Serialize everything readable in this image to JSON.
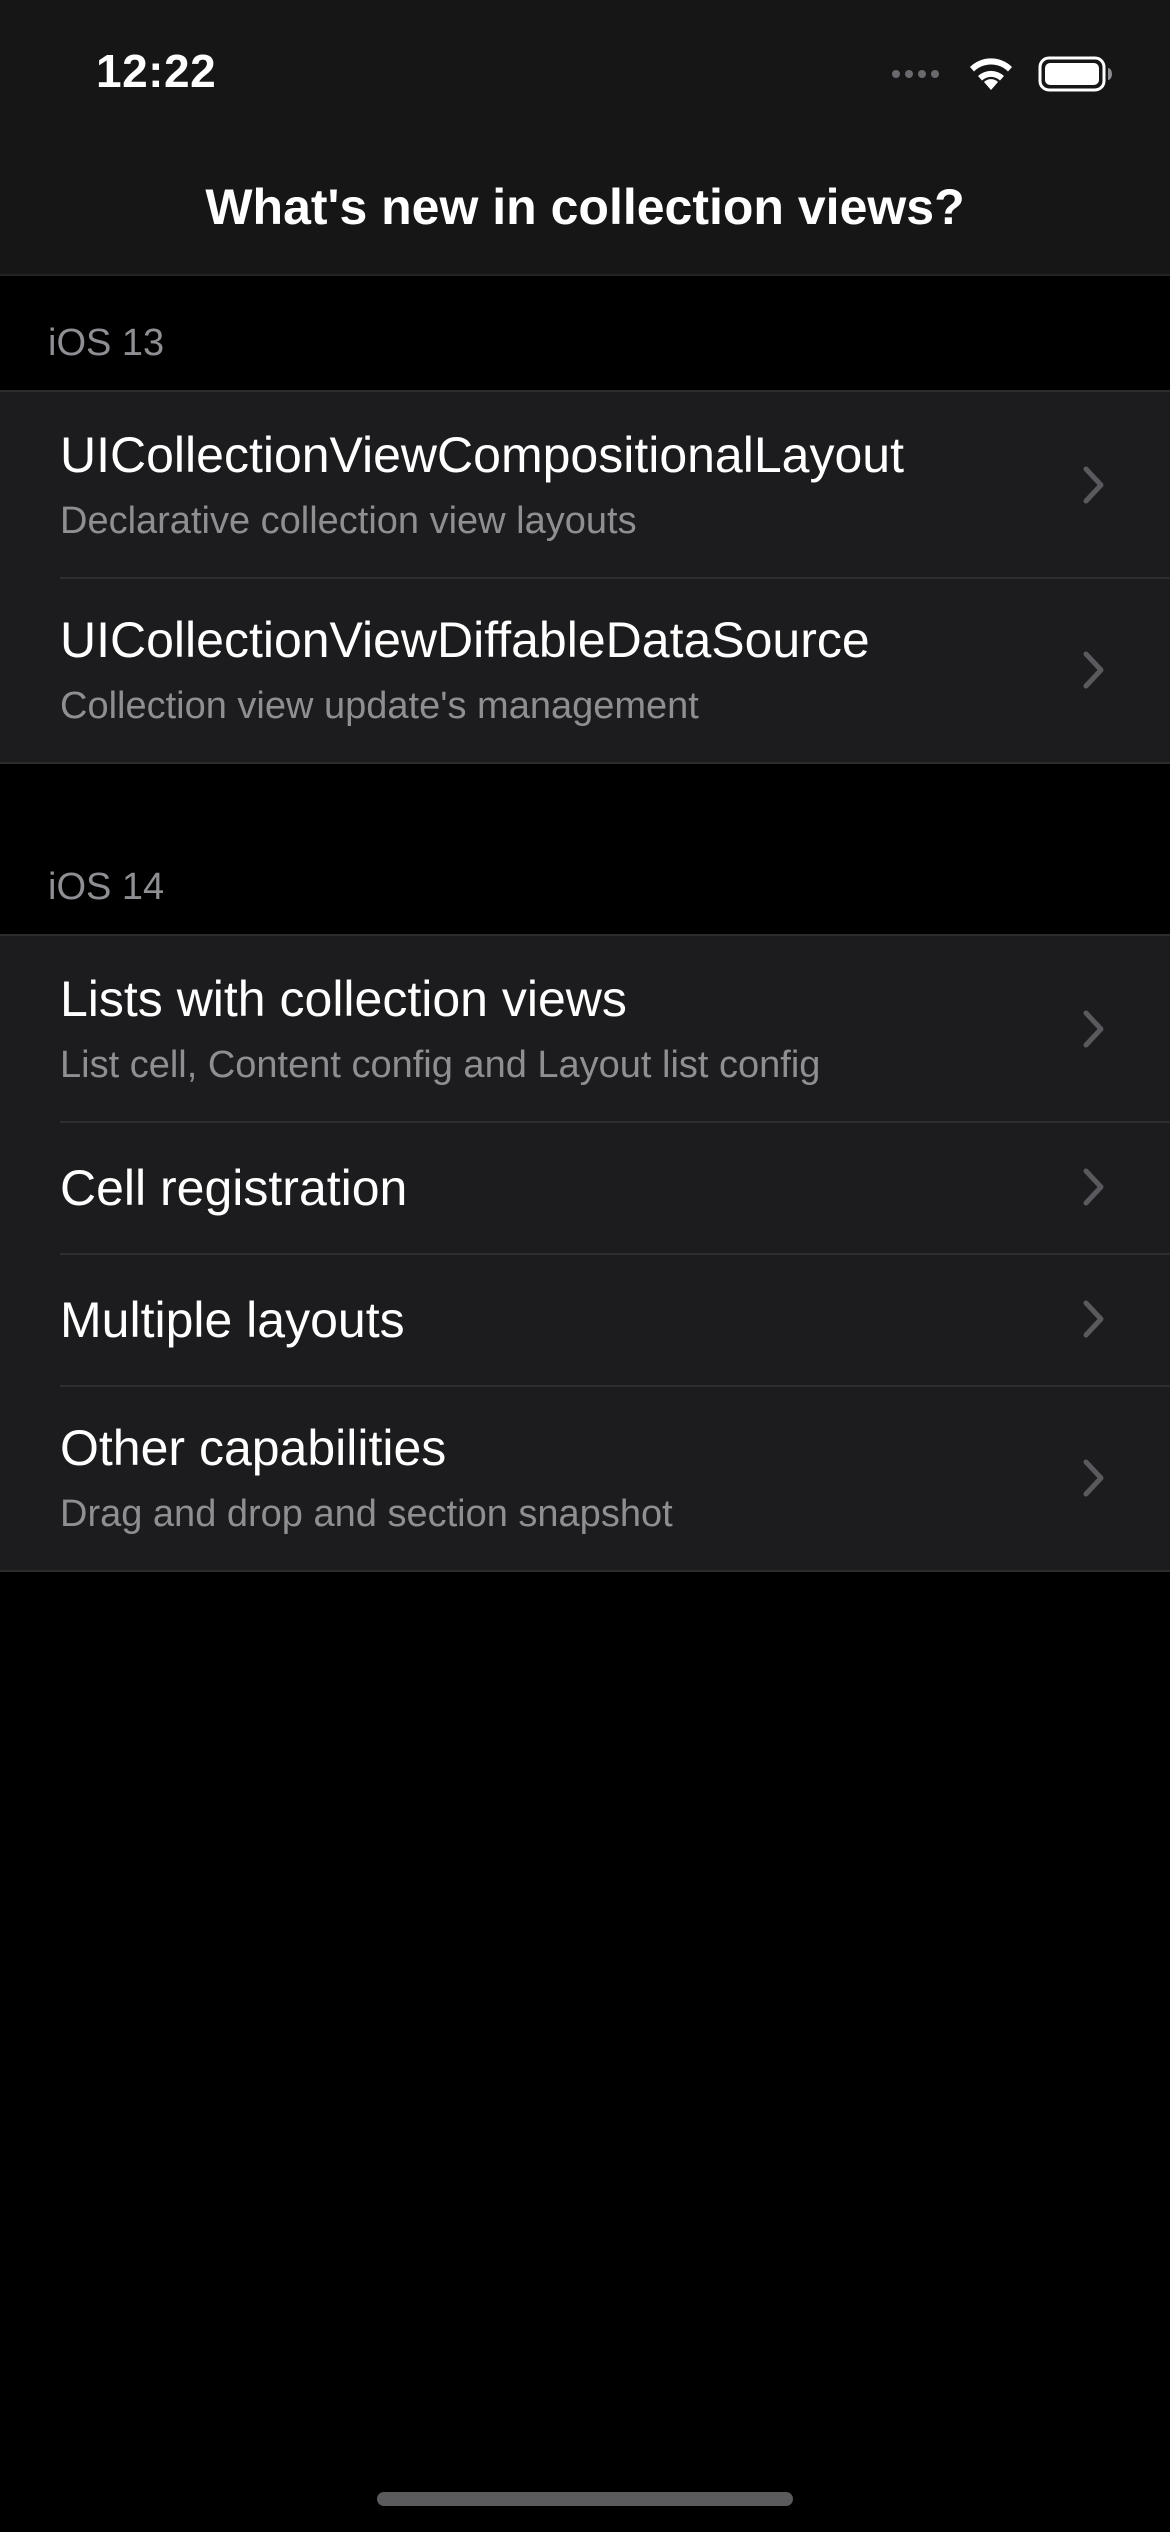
{
  "status_bar": {
    "time": "12:22"
  },
  "nav": {
    "title": "What's new in collection views?"
  },
  "sections": [
    {
      "header": "iOS 13",
      "rows": [
        {
          "title": "UICollectionViewCompositionalLayout",
          "subtitle": "Declarative collection view layouts"
        },
        {
          "title": "UICollectionViewDiffableDataSource",
          "subtitle": "Collection view update's management"
        }
      ]
    },
    {
      "header": "iOS 14",
      "rows": [
        {
          "title": "Lists with collection views",
          "subtitle": "List cell, Content config and Layout list config"
        },
        {
          "title": "Cell registration"
        },
        {
          "title": "Multiple layouts"
        },
        {
          "title": "Other capabilities",
          "subtitle": "Drag and drop and section snapshot"
        }
      ]
    }
  ],
  "icons": {
    "row_accessory": "chevron-right-icon",
    "status": [
      "signal-icon",
      "wifi-icon",
      "battery-icon"
    ]
  },
  "colors": {
    "background": "#000000",
    "cell_background": "#1c1c1e",
    "secondary_text": "#8e8e93",
    "chevron": "#5a5a5e"
  }
}
